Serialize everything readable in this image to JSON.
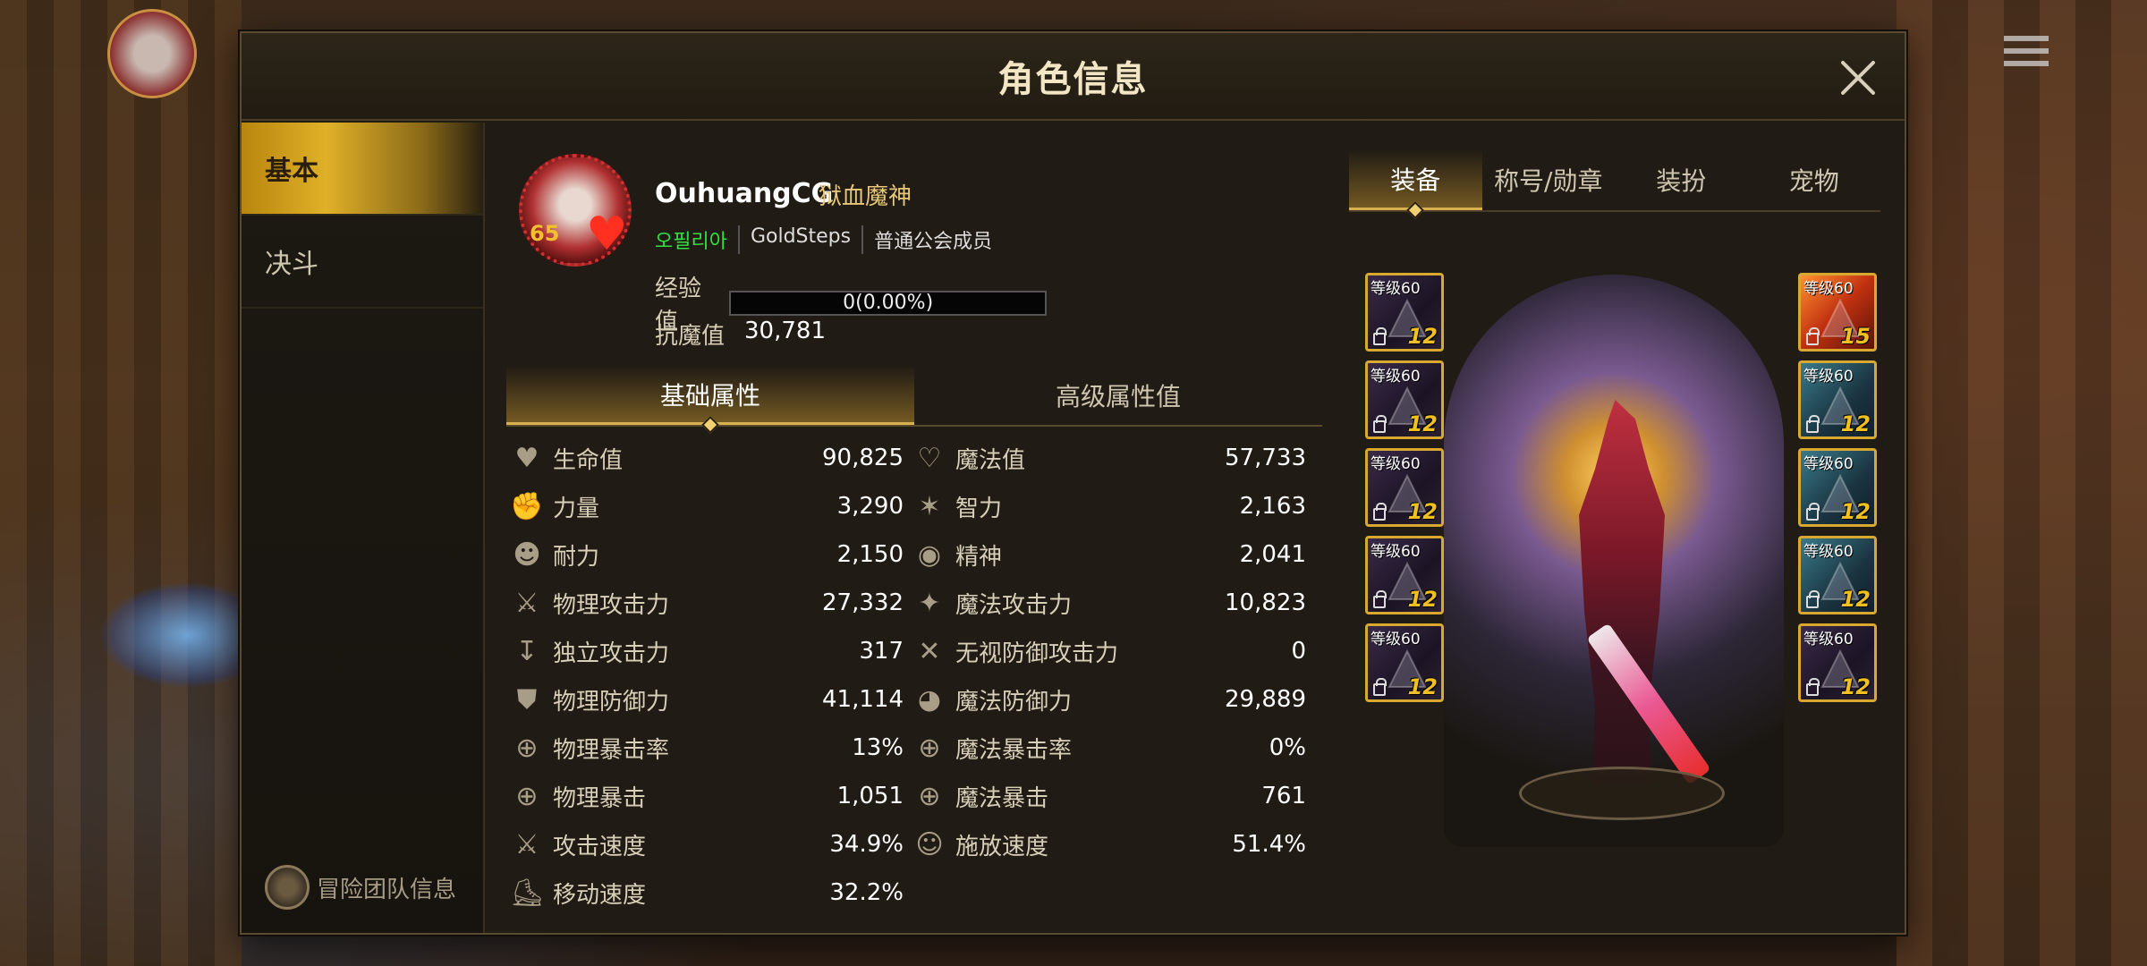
{
  "window": {
    "title": "角色信息"
  },
  "sidebar": {
    "tabs": [
      {
        "label": "基本",
        "active": true
      },
      {
        "label": "决斗",
        "active": false
      }
    ],
    "team_info": "冒险团队信息"
  },
  "profile": {
    "name": "OuhuangCG",
    "title": "狱血魔神",
    "level": "65",
    "tags": [
      "오필리아",
      "GoldSteps",
      "普通公会成员"
    ],
    "exp_label": "经验值",
    "exp_value": "0(0.00%)",
    "exp_fraction": 0.0,
    "resist_label": "抗魔值",
    "resist_value": "30,781"
  },
  "attr_tabs": [
    {
      "label": "基础属性",
      "active": true
    },
    {
      "label": "高级属性值",
      "active": false
    }
  ],
  "stats": [
    {
      "left": {
        "icon": "heart-icon",
        "label": "生命值",
        "value": "90,825"
      },
      "right": {
        "icon": "heart-outline-icon",
        "label": "魔法值",
        "value": "57,733"
      }
    },
    {
      "left": {
        "icon": "fist-icon",
        "label": "力量",
        "value": "3,290"
      },
      "right": {
        "icon": "sparkle-icon",
        "label": "智力",
        "value": "2,163"
      }
    },
    {
      "left": {
        "icon": "person-icon",
        "label": "耐力",
        "value": "2,150"
      },
      "right": {
        "icon": "eye-icon",
        "label": "精神",
        "value": "2,041"
      }
    },
    {
      "left": {
        "icon": "sword-icon",
        "label": "物理攻击力",
        "value": "27,332"
      },
      "right": {
        "icon": "magic-star-icon",
        "label": "魔法攻击力",
        "value": "10,823"
      }
    },
    {
      "left": {
        "icon": "dagger-down-icon",
        "label": "独立攻击力",
        "value": "317"
      },
      "right": {
        "icon": "crossed-shield-icon",
        "label": "无视防御攻击力",
        "value": "0"
      }
    },
    {
      "left": {
        "icon": "shield-icon",
        "label": "物理防御力",
        "value": "41,114"
      },
      "right": {
        "icon": "magic-orb-icon",
        "label": "魔法防御力",
        "value": "29,889"
      }
    },
    {
      "left": {
        "icon": "crosshair-icon",
        "label": "物理暴击率",
        "value": "13%"
      },
      "right": {
        "icon": "crosshair-icon",
        "label": "魔法暴击率",
        "value": "0%"
      }
    },
    {
      "left": {
        "icon": "crosshair-icon",
        "label": "物理暴击",
        "value": "1,051"
      },
      "right": {
        "icon": "crosshair-icon",
        "label": "魔法暴击",
        "value": "761"
      }
    },
    {
      "left": {
        "icon": "swift-sword-icon",
        "label": "攻击速度",
        "value": "34.9%"
      },
      "right": {
        "icon": "head-icon",
        "label": "施放速度",
        "value": "51.4%"
      }
    },
    {
      "left": {
        "icon": "boot-icon",
        "label": "移动速度",
        "value": "32.2%"
      },
      "right": null
    }
  ],
  "equip_tabs": [
    {
      "label": "装备",
      "active": true
    },
    {
      "label": "称号/勋章",
      "active": false
    },
    {
      "label": "装扮",
      "active": false
    },
    {
      "label": "宠物",
      "active": false
    }
  ],
  "equip_slots": {
    "left": [
      {
        "level": "等级60",
        "enh": "12",
        "tone": "purple"
      },
      {
        "level": "等级60",
        "enh": "12",
        "tone": "purple"
      },
      {
        "level": "等级60",
        "enh": "12",
        "tone": "purple"
      },
      {
        "level": "等级60",
        "enh": "12",
        "tone": "purple"
      },
      {
        "level": "等级60",
        "enh": "12",
        "tone": "purple"
      }
    ],
    "right": [
      {
        "level": "等级60",
        "enh": "15",
        "tone": "orange"
      },
      {
        "level": "等级60",
        "enh": "12",
        "tone": "blue"
      },
      {
        "level": "等级60",
        "enh": "12",
        "tone": "blue"
      },
      {
        "level": "等级60",
        "enh": "12",
        "tone": "blue"
      },
      {
        "level": "等级60",
        "enh": "12",
        "tone": "purple"
      }
    ]
  }
}
